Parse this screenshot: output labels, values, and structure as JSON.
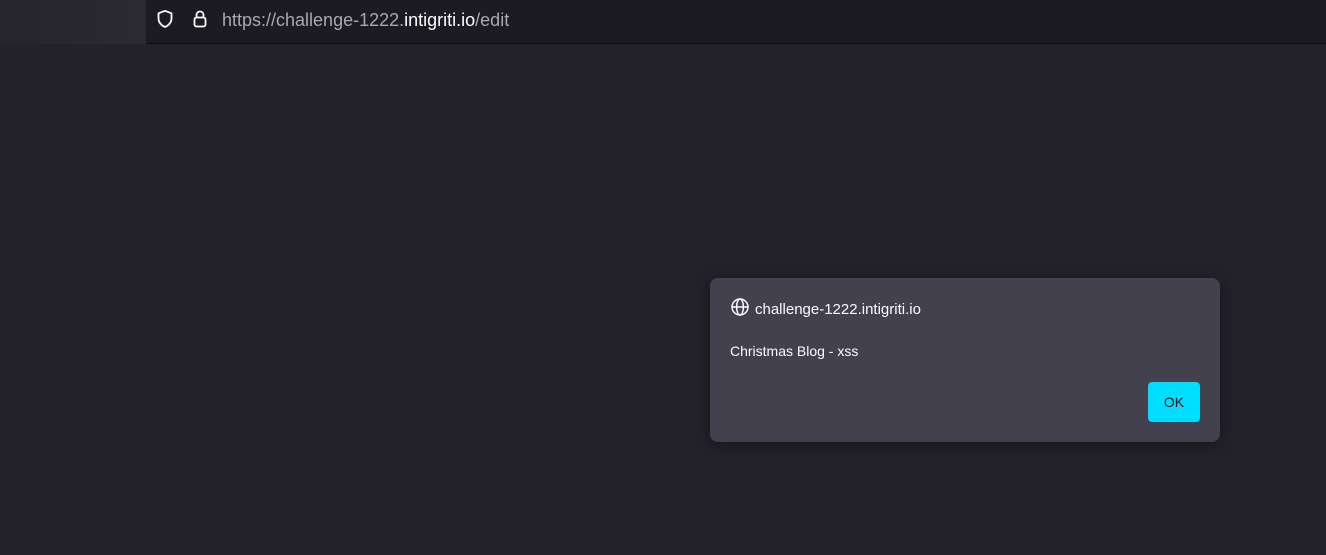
{
  "browser": {
    "url_prefix": "https://challenge-1222.",
    "url_host": "intigriti.io",
    "url_path": "/edit",
    "icons": [
      "shield-icon",
      "lock-icon"
    ]
  },
  "dialog": {
    "origin": "challenge-1222.intigriti.io",
    "icon": "globe-icon",
    "message": "Christmas Blog - xss",
    "ok_label": "OK"
  },
  "colors": {
    "page_background": "#23222b",
    "toolbar_background": "#1c1b22",
    "dialog_background": "#42414d",
    "accent": "#00ddff"
  }
}
